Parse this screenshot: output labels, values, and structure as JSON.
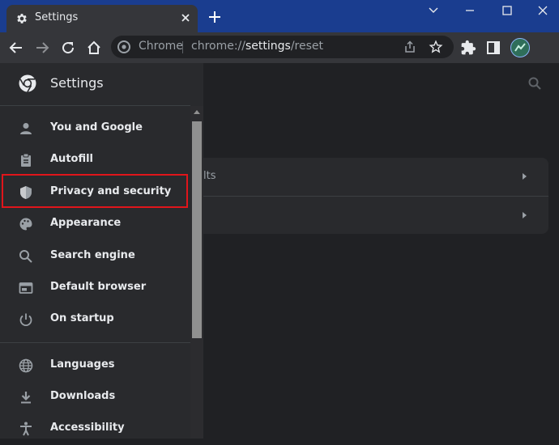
{
  "tab": {
    "title": "Settings"
  },
  "omnibox": {
    "chip": "Chrome",
    "url_prefix": "chrome://",
    "url_path": "settings",
    "url_suffix": "/reset"
  },
  "header": {
    "title": "Settings"
  },
  "nav": {
    "items": [
      {
        "label": "You and Google",
        "icon": "person-icon"
      },
      {
        "label": "Autofill",
        "icon": "clipboard-icon"
      },
      {
        "label": "Privacy and security",
        "icon": "shield-icon",
        "highlighted": true
      },
      {
        "label": "Appearance",
        "icon": "palette-icon"
      },
      {
        "label": "Search engine",
        "icon": "search-icon"
      },
      {
        "label": "Default browser",
        "icon": "browser-window-icon"
      },
      {
        "label": "On startup",
        "icon": "power-icon"
      },
      {
        "label": "Languages",
        "icon": "globe-icon"
      },
      {
        "label": "Downloads",
        "icon": "download-icon"
      },
      {
        "label": "Accessibility",
        "icon": "accessibility-icon"
      }
    ]
  },
  "card": {
    "row1": "lts"
  },
  "colors": {
    "titlebar": "#1a3d8f",
    "highlight_border": "#e0151b",
    "drawer": "#292a2d"
  }
}
